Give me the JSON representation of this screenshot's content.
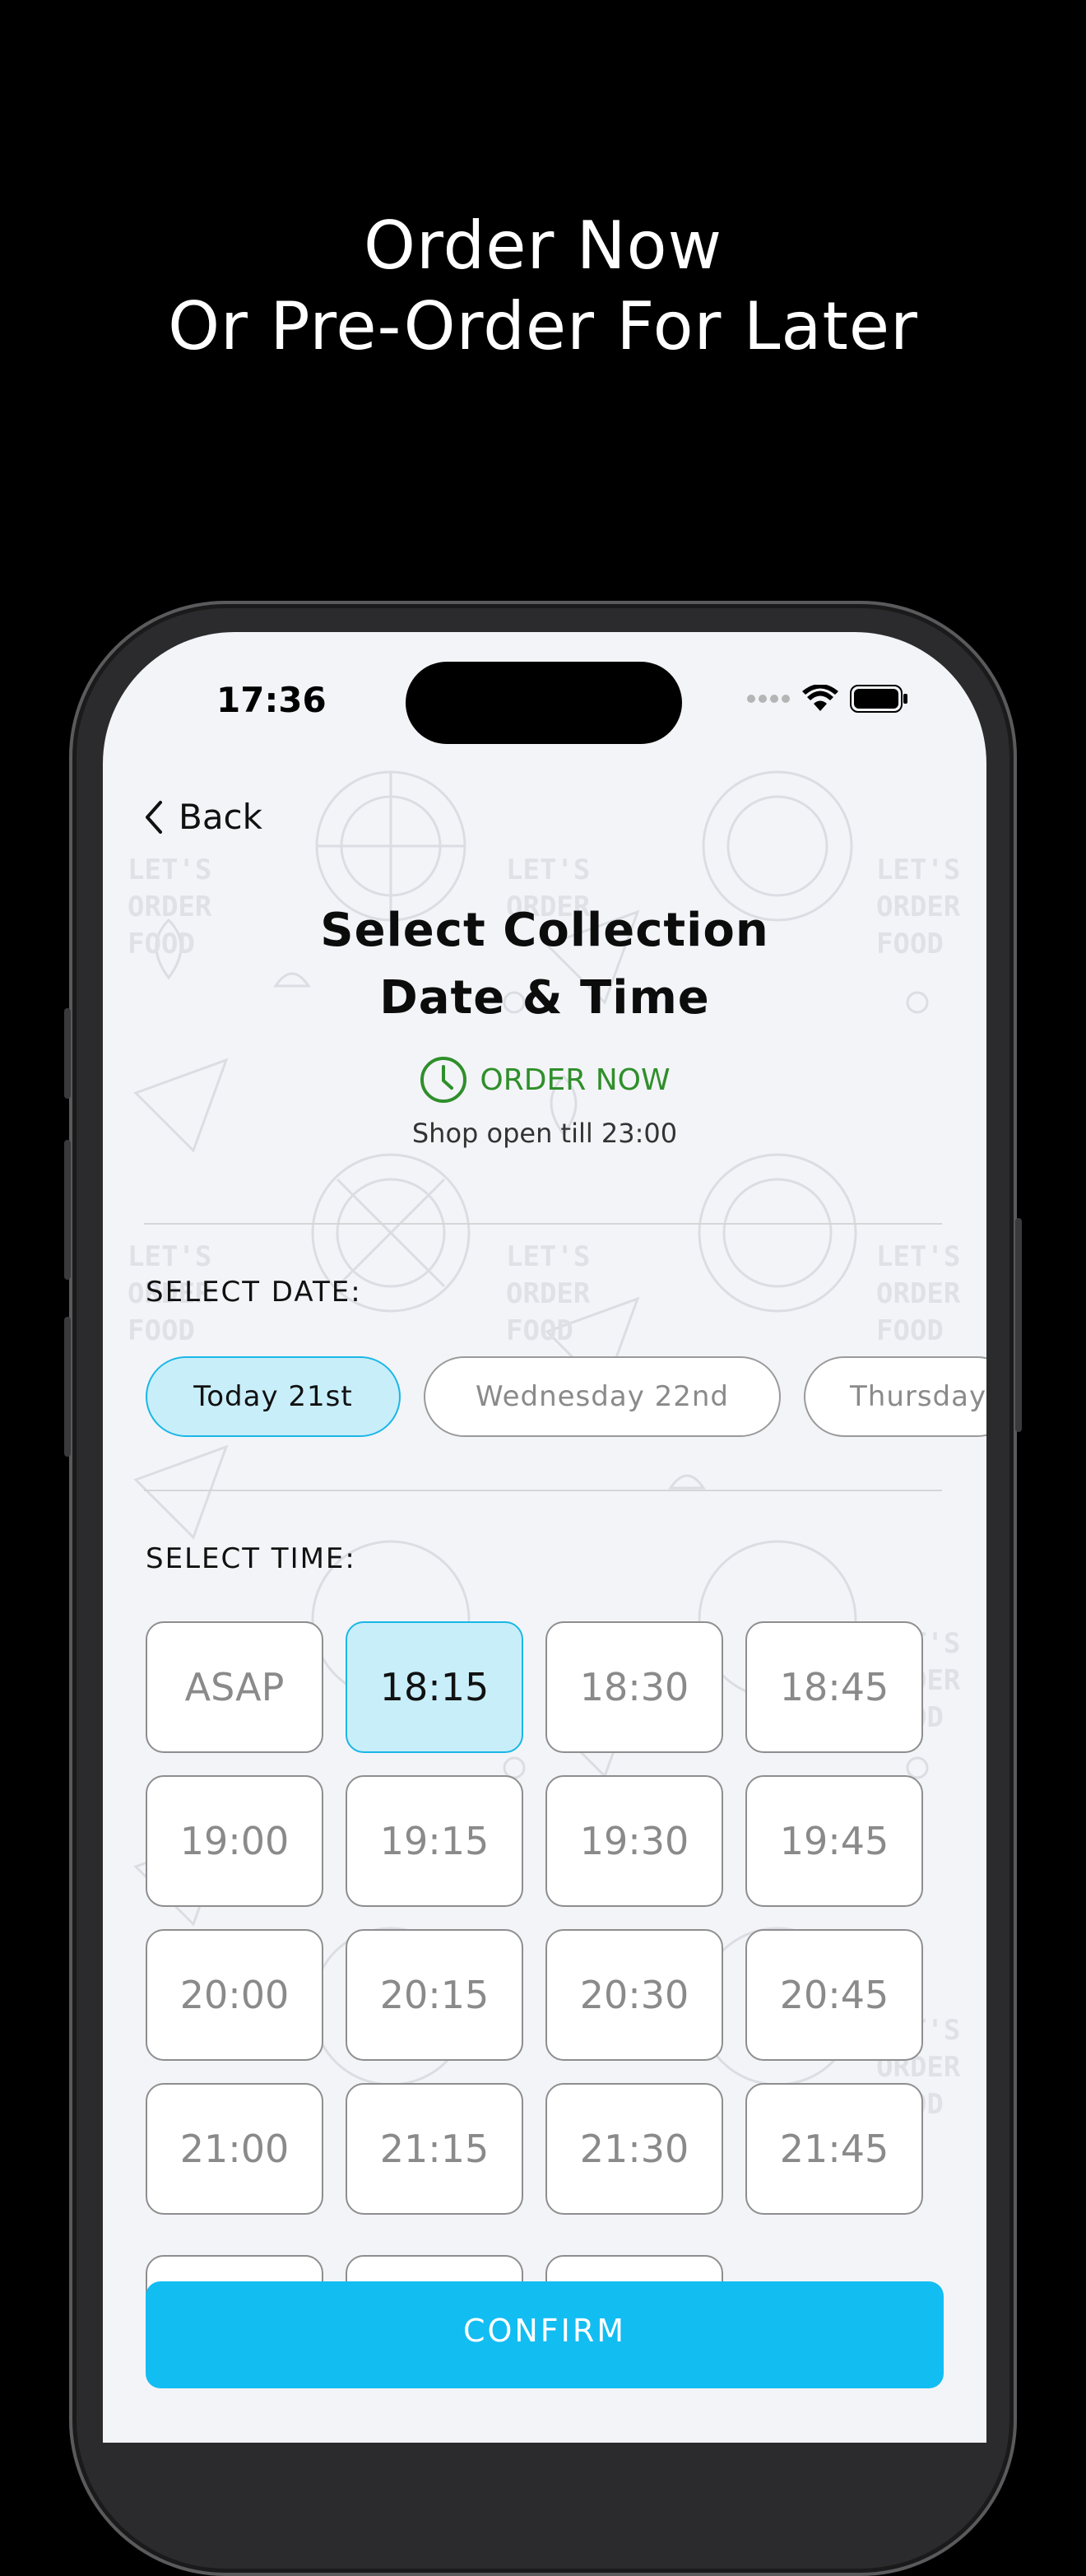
{
  "promo": {
    "line1": "Order Now",
    "line2": "Or Pre-Order For Later"
  },
  "status_bar": {
    "time": "17:36",
    "icons": [
      "signal-dots-icon",
      "wifi-icon",
      "battery-icon"
    ]
  },
  "nav": {
    "back_label": "Back"
  },
  "header": {
    "title_line1": "Select Collection",
    "title_line2": "Date & Time",
    "order_now_label": "ORDER NOW",
    "shop_open": "Shop open till 23:00"
  },
  "date_section": {
    "label": "SELECT DATE:",
    "options": [
      {
        "label": "Today 21st",
        "selected": true
      },
      {
        "label": "Wednesday 22nd",
        "selected": false
      },
      {
        "label": "Thursday",
        "selected": false
      }
    ]
  },
  "time_section": {
    "label": "SELECT TIME:",
    "slots": [
      "ASAP",
      "18:15",
      "18:30",
      "18:45",
      "19:00",
      "19:15",
      "19:30",
      "19:45",
      "20:00",
      "20:15",
      "20:30",
      "20:45",
      "21:00",
      "21:15",
      "21:30",
      "21:45"
    ],
    "selected": "18:15"
  },
  "actions": {
    "confirm_label": "CONFIRM"
  },
  "colors": {
    "accent": "#12bdf2",
    "selected_fill": "#c8eefa",
    "order_now_green": "#2f8f2b",
    "background": "#000000"
  }
}
